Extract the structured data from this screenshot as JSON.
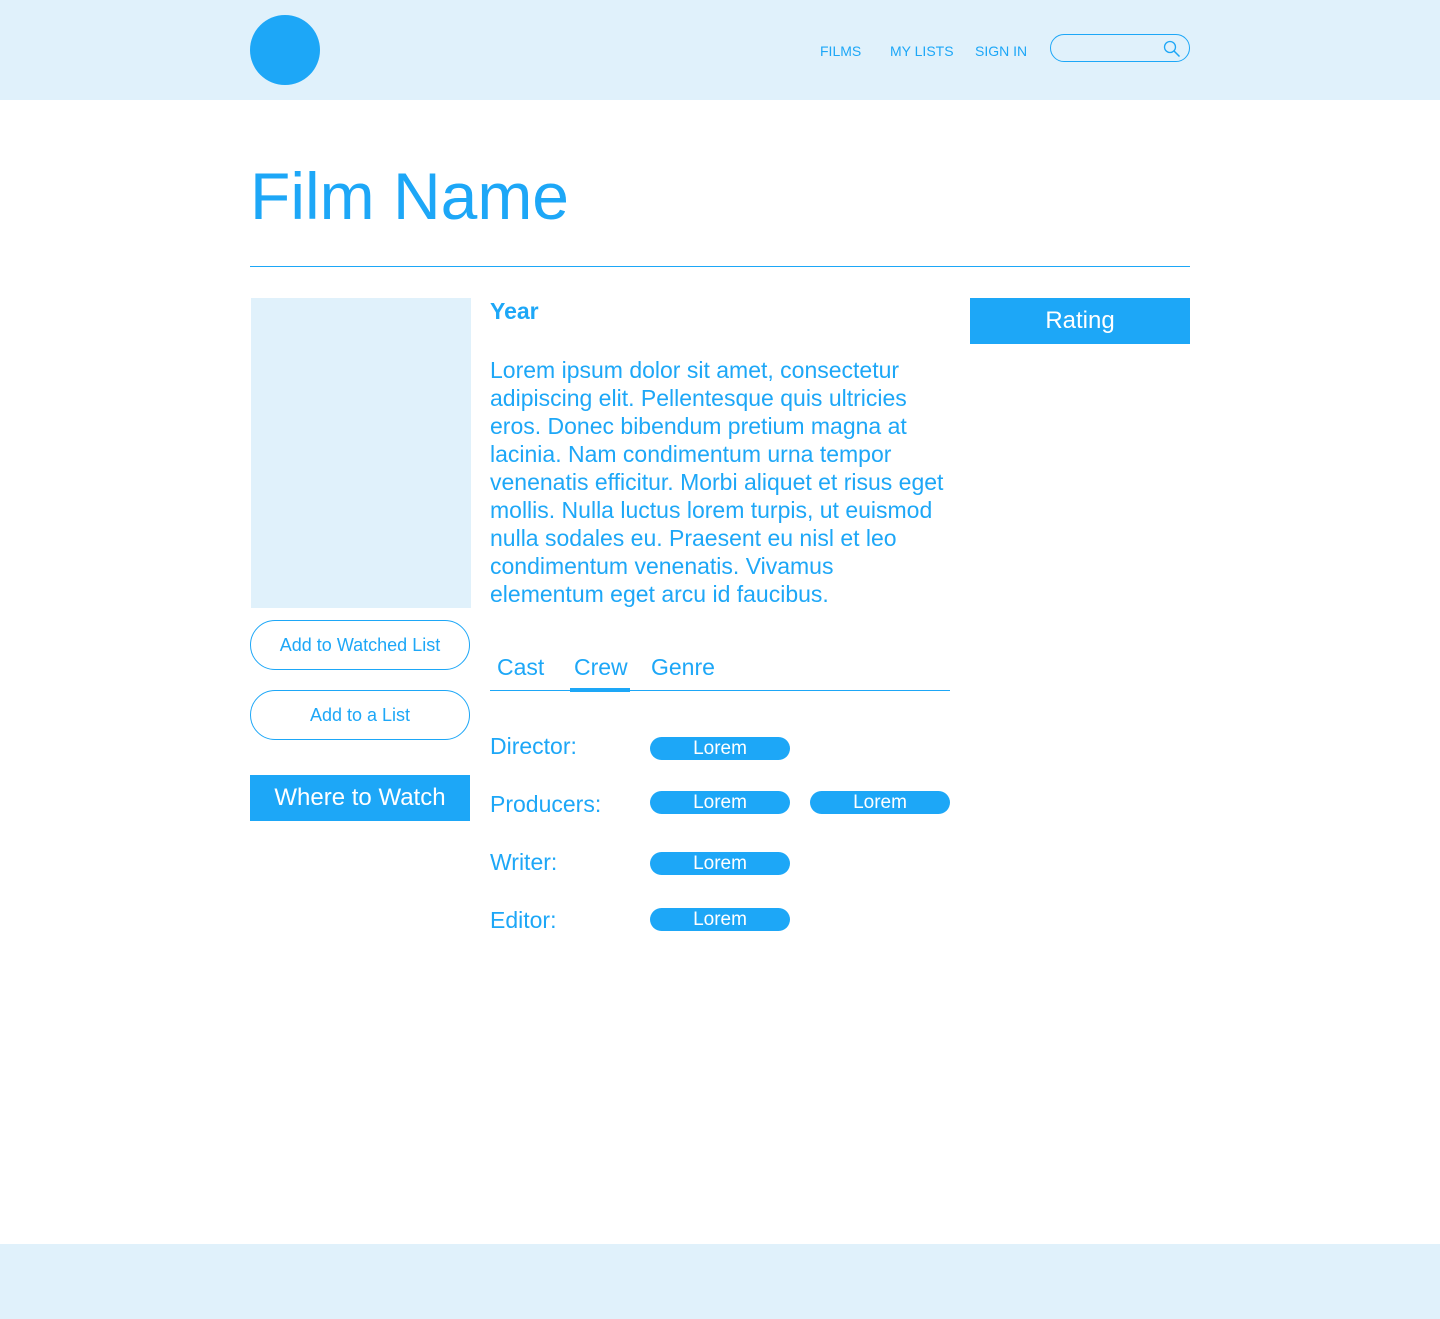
{
  "colors": {
    "accent": "#1da7f7",
    "light_bg": "#e0f1fb"
  },
  "nav": {
    "films": "FILMS",
    "my_lists": "MY LISTS",
    "sign_in": "SIGN IN"
  },
  "search": {
    "value": "",
    "placeholder": "",
    "icon": "search-icon"
  },
  "film": {
    "title": "Film Name",
    "year": "Year",
    "synopsis": "Lorem ipsum dolor sit amet, consectetur adipiscing elit. Pellentesque quis ultricies eros. Donec bibendum pretium magna at lacinia. Nam condimentum urna tempor venenatis efficitur. Morbi aliquet et risus eget mollis. Nulla luctus lorem turpis, ut euismod nulla sodales eu. Praesent eu nisl et leo condimentum venenatis. Vivamus elementum eget arcu id faucibus."
  },
  "actions": {
    "add_watched": "Add to Watched List",
    "add_list": "Add to a List",
    "where_to_watch": "Where to Watch",
    "rating": "Rating"
  },
  "tabs": [
    {
      "label": "Cast",
      "active": false
    },
    {
      "label": "Crew",
      "active": true
    },
    {
      "label": "Genre",
      "active": false
    }
  ],
  "crew": [
    {
      "role": "Director:",
      "names": [
        "Lorem"
      ]
    },
    {
      "role": "Producers:",
      "names": [
        "Lorem",
        "Lorem"
      ]
    },
    {
      "role": "Writer:",
      "names": [
        "Lorem"
      ]
    },
    {
      "role": "Editor:",
      "names": [
        "Lorem"
      ]
    }
  ]
}
